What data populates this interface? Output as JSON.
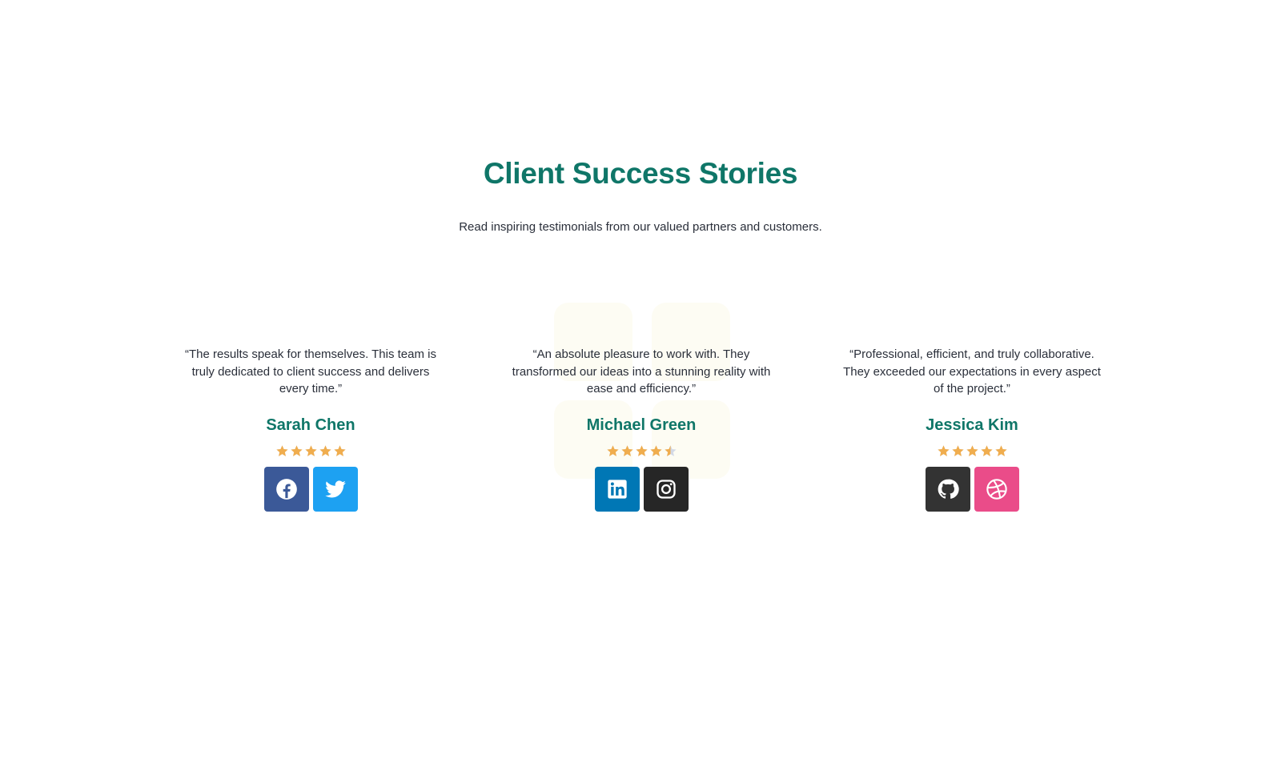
{
  "section": {
    "title": "Client Success Stories",
    "subtitle": "Read inspiring testimonials from our valued partners and customers."
  },
  "colors": {
    "accent": "#0f7668",
    "star": "#f0ad4e",
    "star_empty": "#d3d9e6",
    "deco": "#fdfcf3"
  },
  "testimonials": [
    {
      "quote": "“The results speak for themselves. This team is truly dedicated to client success and delivers every time.”",
      "name": "Sarah Chen",
      "rating": 5,
      "socials": [
        {
          "icon": "facebook-icon",
          "color": "#3b5998"
        },
        {
          "icon": "twitter-icon",
          "color": "#1da1f2"
        }
      ]
    },
    {
      "quote": "“An absolute pleasure to work with. They transformed our ideas into a stunning reality with ease and efficiency.”",
      "name": "Michael Green",
      "rating": 4.5,
      "socials": [
        {
          "icon": "linkedin-icon",
          "color": "#0077b5"
        },
        {
          "icon": "instagram-icon",
          "color": "#262626"
        }
      ]
    },
    {
      "quote": "“Professional, efficient, and truly collaborative. They exceeded our expectations in every aspect of the project.”",
      "name": "Jessica Kim",
      "rating": 5,
      "socials": [
        {
          "icon": "github-icon",
          "color": "#333333"
        },
        {
          "icon": "dribbble-icon",
          "color": "#ea4c89"
        }
      ]
    }
  ]
}
